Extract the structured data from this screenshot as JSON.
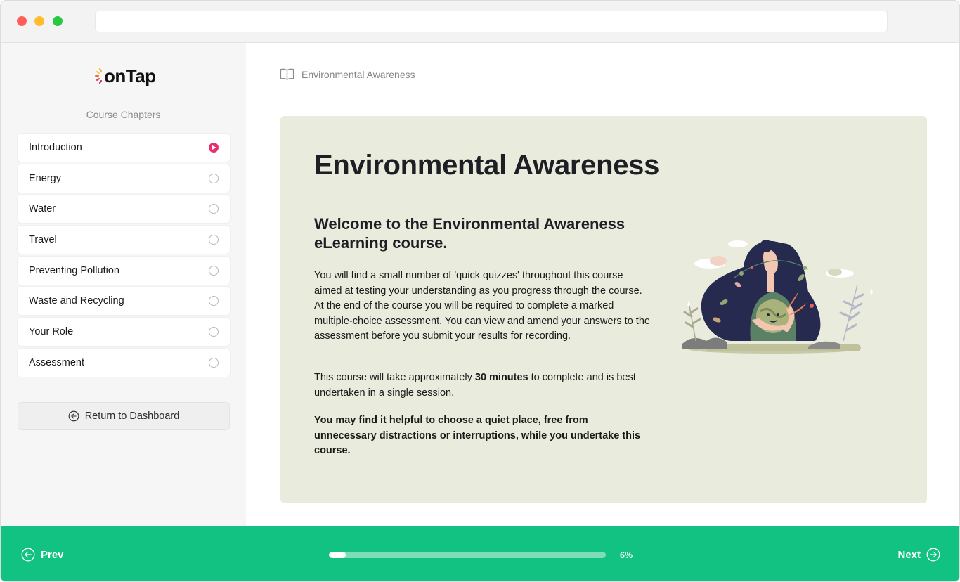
{
  "sidebar": {
    "logo_text": "onTap",
    "chapters_title": "Course Chapters",
    "chapters": [
      {
        "label": "Introduction",
        "status": "active"
      },
      {
        "label": "Energy",
        "status": "incomplete"
      },
      {
        "label": "Water",
        "status": "incomplete"
      },
      {
        "label": "Travel",
        "status": "incomplete"
      },
      {
        "label": "Preventing Pollution",
        "status": "incomplete"
      },
      {
        "label": "Waste and Recycling",
        "status": "incomplete"
      },
      {
        "label": "Your Role",
        "status": "incomplete"
      },
      {
        "label": "Assessment",
        "status": "incomplete"
      }
    ],
    "return_label": "Return to Dashboard"
  },
  "main": {
    "breadcrumb": "Environmental Awareness",
    "title": "Environmental Awareness",
    "welcome": "Welcome to the Environmental Awareness eLearning course.",
    "para1": "You will find a small number of 'quick quizzes' throughout this course aimed at testing your understanding as you progress through the course.  At the end of the course you will be required to complete a marked multiple-choice assessment. You can view and amend your answers to the assessment before you submit your results for recording.",
    "para2_before": "This course will take approximately ",
    "para2_bold": "30 minutes",
    "para2_after": " to complete and is best undertaken in a single session.",
    "para3": "You may find it helpful to choose a quiet place, free from unnecessary distractions or interruptions, while you undertake this course."
  },
  "footer": {
    "prev_label": "Prev",
    "next_label": "Next",
    "progress_percent": 6,
    "progress_label": "6%"
  },
  "colors": {
    "accent_green": "#12c282",
    "active_pink": "#ea2e6d",
    "card_bg": "#e9ecdc"
  }
}
